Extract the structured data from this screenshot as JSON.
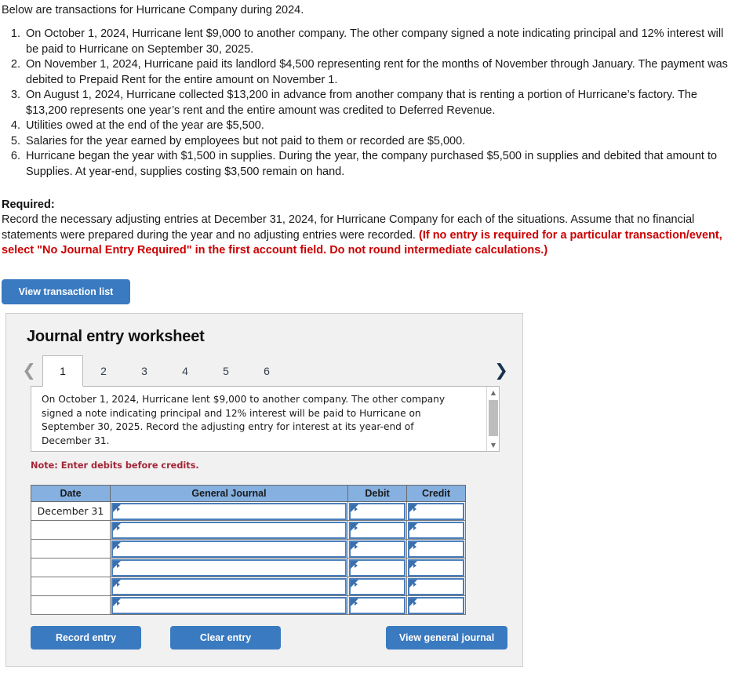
{
  "intro": {
    "lead": "Below are transactions for Hurricane Company during 2024."
  },
  "transactions": [
    "On October 1, 2024, Hurricane lent $9,000 to another company. The other company signed a note indicating principal and 12% interest will be paid to Hurricane on September 30, 2025.",
    "On November 1, 2024, Hurricane paid its landlord $4,500 representing rent for the months of November through January. The payment was debited to Prepaid Rent for the entire amount on November 1.",
    "On August 1, 2024, Hurricane collected $13,200 in advance from another company that is renting a portion of Hurricane’s factory. The $13,200 represents one year’s rent and the entire amount was credited to Deferred Revenue.",
    "Utilities owed at the end of the year are $5,500.",
    "Salaries for the year earned by employees but not paid to them or recorded are $5,000.",
    "Hurricane began the year with $1,500 in supplies. During the year, the company purchased $5,500 in supplies and debited that amount to Supplies. At year-end, supplies costing $3,500 remain on hand."
  ],
  "required": {
    "label": "Required:",
    "body_plain": "Record the necessary adjusting entries at December 31, 2024, for Hurricane Company for each of the situations. Assume that no financial statements were prepared during the year and no adjusting entries were recorded. ",
    "body_red": "(If no entry is required for a particular transaction/event, select \"No Journal Entry Required\" in the first account field. Do not round intermediate calculations.)",
    "red_color": "#cc0000"
  },
  "buttons": {
    "view_transaction_list": "View transaction list",
    "record_entry": "Record entry",
    "clear_entry": "Clear entry",
    "view_general_journal": "View general journal",
    "accent_color": "#3a7ac0"
  },
  "worksheet": {
    "title": "Journal entry worksheet",
    "prev_icon": "chevron-left-icon",
    "next_icon": "chevron-right-icon",
    "tabs": [
      {
        "label": "1",
        "active": true
      },
      {
        "label": "2",
        "active": false
      },
      {
        "label": "3",
        "active": false
      },
      {
        "label": "4",
        "active": false
      },
      {
        "label": "5",
        "active": false
      },
      {
        "label": "6",
        "active": false
      }
    ],
    "description": "On October 1, 2024, Hurricane lent $9,000 to another company. The other company signed a note indicating principal and 12% interest will be paid to Hurricane on September 30, 2025. Record the adjusting entry for interest at its year-end of December 31.",
    "note": "Note: Enter debits before credits.",
    "note_color": "#a32638",
    "scrollbar": {
      "up_icon": "triangle-up-icon",
      "down_icon": "triangle-down-icon"
    },
    "table": {
      "headers": [
        "Date",
        "General Journal",
        "Debit",
        "Credit"
      ],
      "header_color": "#85b0e0",
      "rows": [
        {
          "date": "December 31",
          "general_journal": "",
          "debit": "",
          "credit": ""
        },
        {
          "date": "",
          "general_journal": "",
          "debit": "",
          "credit": ""
        },
        {
          "date": "",
          "general_journal": "",
          "debit": "",
          "credit": ""
        },
        {
          "date": "",
          "general_journal": "",
          "debit": "",
          "credit": ""
        },
        {
          "date": "",
          "general_journal": "",
          "debit": "",
          "credit": ""
        },
        {
          "date": "",
          "general_journal": "",
          "debit": "",
          "credit": ""
        }
      ]
    }
  }
}
